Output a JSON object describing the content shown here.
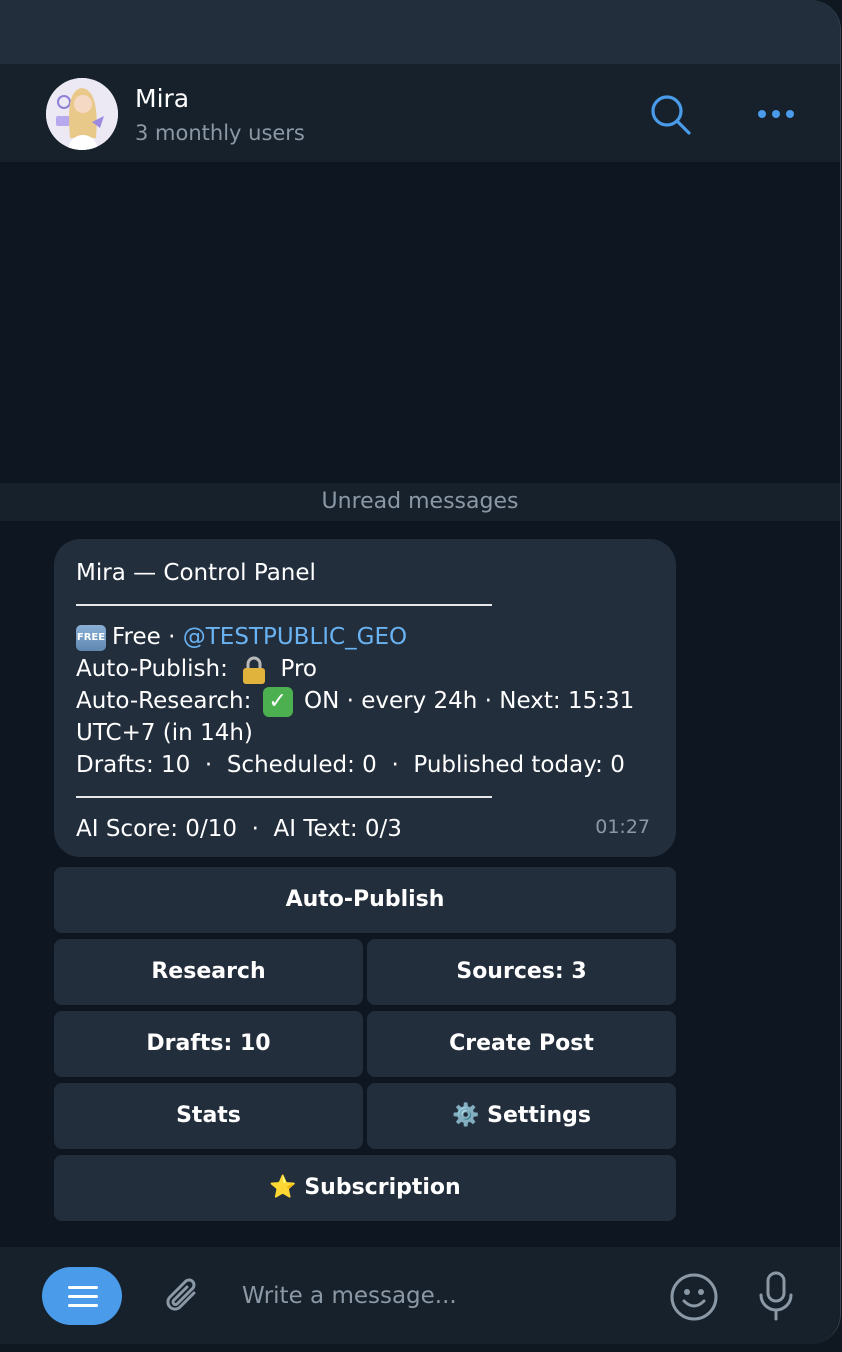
{
  "chat": {
    "name": "Mira",
    "status": "3 monthly users"
  },
  "messages": {
    "unread_label": "Unread messages",
    "bubble": {
      "title": "Mira — Control Panel",
      "plan": "Free · ",
      "channel": "@TESTPUBLIC_GEO",
      "auto_publish_label": "Auto-Publish: ",
      "auto_publish_value": " Pro",
      "auto_research_label": "Auto-Research: ",
      "auto_research_value": " ON · every 24h · Next: 15:31",
      "auto_research_value2": "UTC+7 (in 14h)",
      "counts": "Drafts: 10  ·  Scheduled: 0  ·  Published today: 0",
      "scores": "AI Score: 0/10  ·  AI Text: 0/3",
      "time": "01:27",
      "free_badge": "FREE"
    }
  },
  "keyboard": {
    "auto_publish": "Auto-Publish",
    "research": "Research",
    "sources": "Sources: 3",
    "drafts": "Drafts: 10",
    "create_post": "Create Post",
    "stats": "Stats",
    "settings": "⚙️ Settings",
    "subscription": "⭐ Subscription"
  },
  "composer": {
    "placeholder": "Write a message..."
  },
  "colors": {
    "accent": "#4a9bea",
    "link": "#6ab3f3",
    "background": "#0e1621",
    "panel": "#17212b",
    "bubble": "#232e3c"
  },
  "icons": [
    "search-icon",
    "more-icon",
    "menu-icon",
    "attach-icon",
    "emoji-icon",
    "mic-icon",
    "lock-icon",
    "check-icon",
    "free-icon"
  ]
}
